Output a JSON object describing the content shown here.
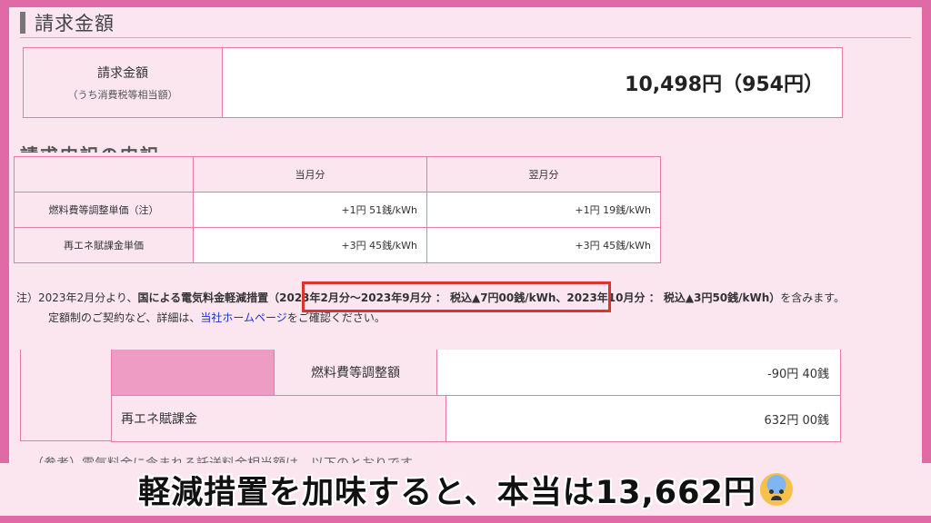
{
  "section": {
    "title": "請求金額"
  },
  "billing": {
    "label_main": "請求金額",
    "label_sub": "（うち消費税等相当額）",
    "value": "10,498円（954円）"
  },
  "partial_heading": "請求内訳の内訳",
  "rates": {
    "headers": [
      "",
      "当月分",
      "翌月分"
    ],
    "rows": [
      {
        "label": "燃料費等調整単価（注）",
        "current": "+1円 51銭/kWh",
        "next": "+1円 19銭/kWh"
      },
      {
        "label": "再エネ賦課金単価",
        "current": "+3円 45銭/kWh",
        "next": "+3円 45銭/kWh"
      }
    ]
  },
  "note": {
    "prefix": "注）2023年2月分より、",
    "bold": "国による電気料金軽減措置",
    "highlight": "（2023年2月分〜2023年9月分 ： 税込▲7円00銭/kWh、",
    "rest": "2023年10月分 ： 税込▲3円50銭/kWh）",
    "suffix": "を含みます。",
    "line2_before": "定額制のご契約など、詳細は、",
    "line2_link": "当社ホームページ",
    "line2_after": "をご確認ください。"
  },
  "fees": [
    {
      "label": "燃料費等調整額",
      "value": "-90円 40銭"
    },
    {
      "label": "再エネ賦課金",
      "value": "632円 00銭"
    }
  ],
  "reference_note": "（参考）電気料金に含まれる託送料金相当額は、以下のとおりです。",
  "subtitle": "軽減措置を加味すると、本当は13,662円",
  "icons": {
    "subtitle_emoji": "anxious-face-with-sweat-icon"
  }
}
